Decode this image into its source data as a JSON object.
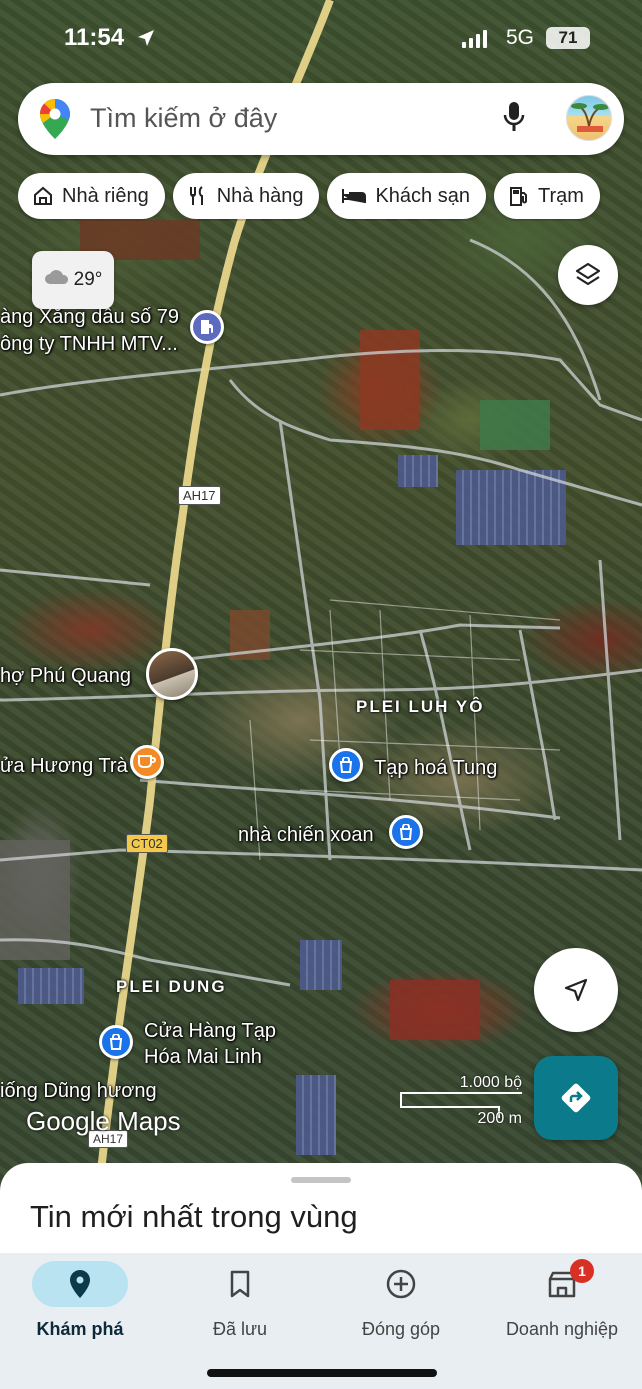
{
  "status_bar": {
    "time": "11:54",
    "network": "5G",
    "battery": "71"
  },
  "search": {
    "placeholder": "Tìm kiếm ở đây"
  },
  "chips": [
    {
      "label": "Nhà riêng",
      "icon": "home-icon"
    },
    {
      "label": "Nhà hàng",
      "icon": "restaurant-icon"
    },
    {
      "label": "Khách sạn",
      "icon": "hotel-icon"
    },
    {
      "label": "Trạm",
      "icon": "gas-station-icon"
    }
  ],
  "weather": {
    "temperature": "29°",
    "icon": "cloud-icon"
  },
  "map": {
    "labels": {
      "gas_station_line1": "àng Xăng dầu số 79",
      "gas_station_line2": "ông ty TNHH MTV...",
      "market": "hợ Phú Quang",
      "cafe": "ửa Hương Trà",
      "shop_tung": "Tạp hoá Tung",
      "nha_chien": "nhà chiến xoan",
      "shop_mai_line1": "Cửa Hàng Tạp",
      "shop_mai_line2": "Hóa Mai Linh",
      "dung_huong": "iống Dũng hương"
    },
    "areas": {
      "plei_luh_yo": "PLEI LUH YÔ",
      "plei_dung": "PLEI DUNG"
    },
    "road_shields": {
      "ah17": "AH17",
      "ct02": "CT02",
      "ah17_bottom": "AH17"
    },
    "attribution": "Google Maps",
    "scale": {
      "imperial": "1.000 bộ",
      "metric": "200 m"
    }
  },
  "sheet": {
    "title": "Tin mới nhất trong vùng"
  },
  "nav": [
    {
      "label": "Khám phá",
      "icon": "explore-pin-icon",
      "active": true
    },
    {
      "label": "Đã lưu",
      "icon": "bookmark-icon"
    },
    {
      "label": "Đóng góp",
      "icon": "add-circle-icon"
    },
    {
      "label": "Doanh nghiệp",
      "icon": "business-icon",
      "badge": "1"
    }
  ],
  "colors": {
    "accent": "#0b7a8a",
    "active_nav_bg": "#b9e3f0",
    "badge": "#d93025"
  }
}
